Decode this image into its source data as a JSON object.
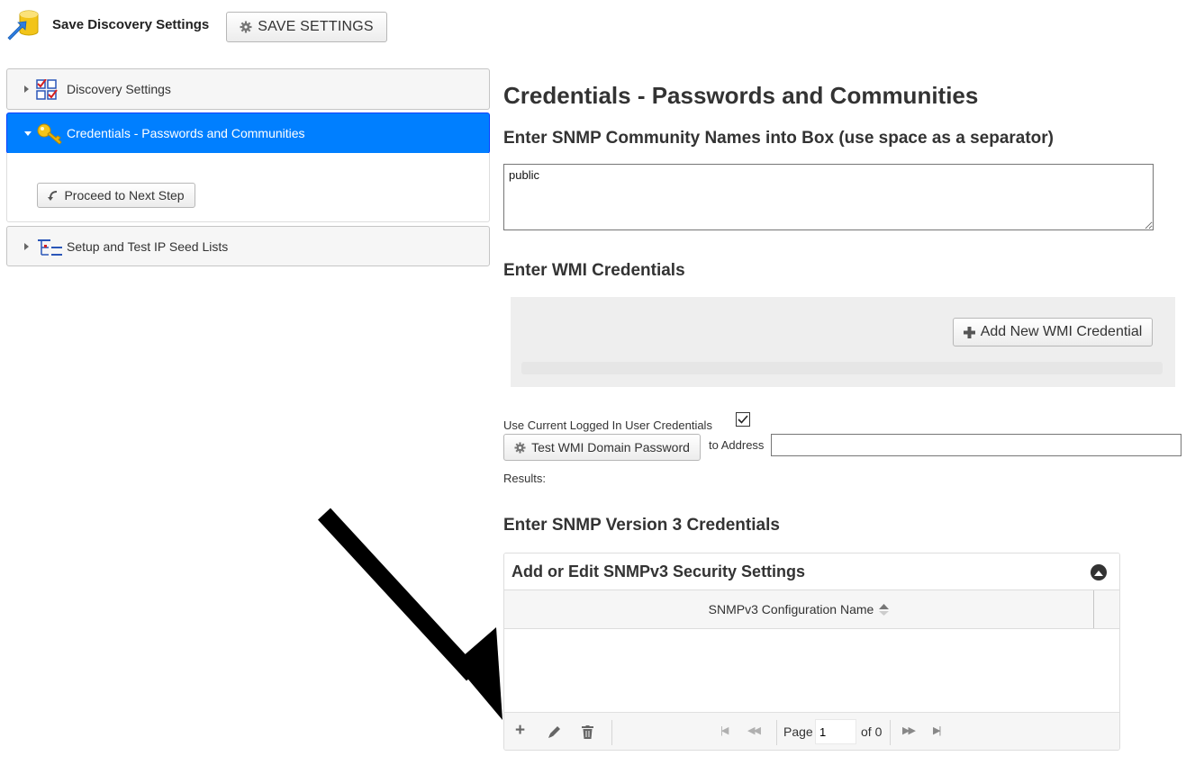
{
  "topbar": {
    "title": "Save Discovery Settings",
    "save_button_label": "SAVE SETTINGS"
  },
  "accordion": {
    "sections": [
      {
        "label": "Discovery Settings",
        "icon": "checklist-icon",
        "expanded": false
      },
      {
        "label": "Credentials - Passwords and Communities",
        "icon": "key-icon",
        "expanded": true
      },
      {
        "label": "Setup and Test IP Seed Lists",
        "icon": "list-tree-icon",
        "expanded": false
      }
    ],
    "proceed_button_label": "Proceed to Next Step"
  },
  "main": {
    "title": "Credentials - Passwords and Communities",
    "snmp_heading": "Enter SNMP Community Names into Box (use space as a separator)",
    "community_value": "public",
    "wmi_heading": "Enter WMI Credentials",
    "add_wmi_label": "Add New WMI Credential",
    "use_current_label": "Use Current Logged In User Credentials",
    "use_current_checked": true,
    "test_wmi_label": "Test WMI Domain Password",
    "to_address_label": "to Address",
    "to_address_value": "",
    "results_label": "Results:",
    "snmpv3_heading": "Enter SNMP Version 3 Credentials"
  },
  "grid": {
    "caption": "Add or Edit SNMPv3 Security Settings",
    "column_header": "SNMPv3 Configuration Name",
    "page_label": "Page",
    "page_value": "1",
    "of_label": "of 0"
  },
  "colors": {
    "active_header": "#007fff",
    "annotation_arrow": "#000000"
  }
}
